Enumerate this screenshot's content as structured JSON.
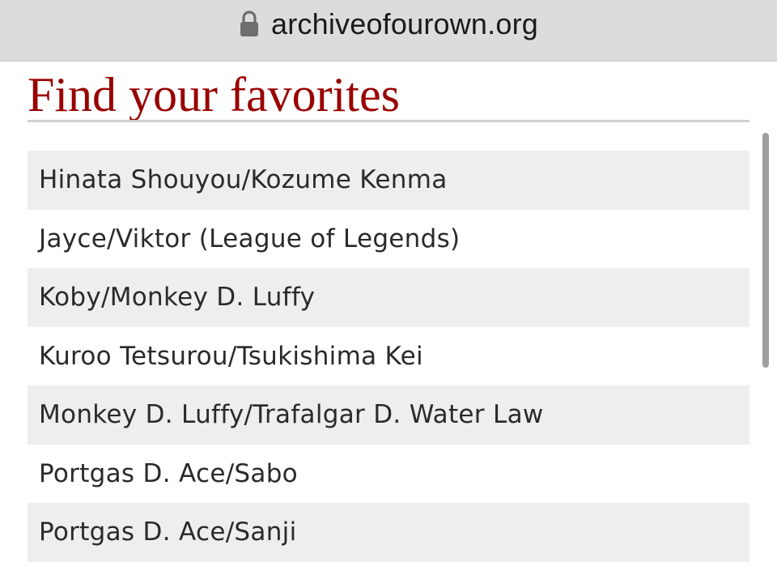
{
  "address_bar": {
    "icon": "lock-icon",
    "url": "archiveofourown.org"
  },
  "page": {
    "title": "Find your favorites",
    "title_color": "#990000"
  },
  "favorites": [
    "Hinata Shouyou/Kozume Kenma",
    "Jayce/Viktor (League of Legends)",
    "Koby/Monkey D. Luffy",
    "Kuroo Tetsurou/Tsukishima Kei",
    "Monkey D. Luffy/Trafalgar D. Water Law",
    "Portgas D. Ace/Sabo",
    "Portgas D. Ace/Sanji"
  ]
}
